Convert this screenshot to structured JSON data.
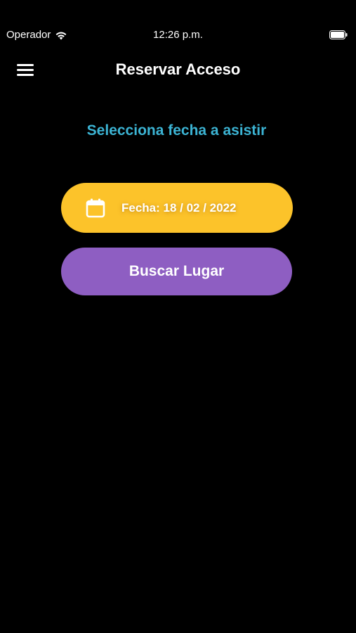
{
  "status_bar": {
    "carrier": "Operador",
    "time": "12:26 p.m."
  },
  "nav": {
    "title": "Reservar Acceso",
    "menu_icon": "hamburger-menu-icon"
  },
  "main": {
    "subtitle": "Selecciona fecha a asistir",
    "date_button_label": "Fecha: 18 / 02 / 2022",
    "date_icon": "calendar-icon",
    "search_button_label": "Buscar Lugar"
  },
  "colors": {
    "background": "#000000",
    "subtitle": "#3cb4d4",
    "date_button": "#fcc32a",
    "search_button": "#8e5ec2",
    "text": "#ffffff"
  }
}
